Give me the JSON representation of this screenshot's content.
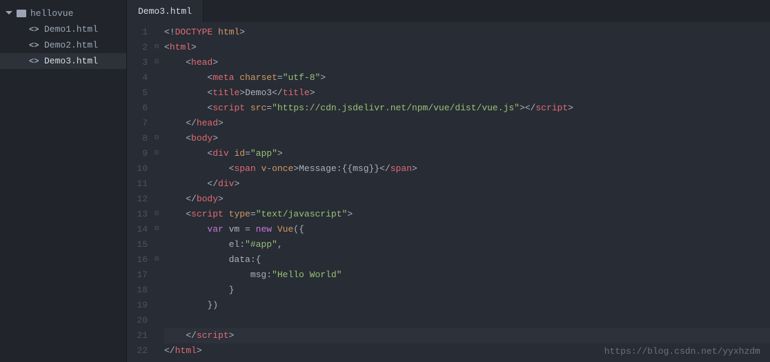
{
  "sidebar": {
    "folder": "hellovue",
    "files": [
      {
        "name": "Demo1.html",
        "selected": false
      },
      {
        "name": "Demo2.html",
        "selected": false
      },
      {
        "name": "Demo3.html",
        "selected": true
      }
    ]
  },
  "tabs": [
    {
      "label": "Demo3.html"
    }
  ],
  "lineCount": 22,
  "foldMarkers": {
    "2": "⊟",
    "3": "⊟",
    "8": "⊟",
    "9": "⊟",
    "13": "⊟",
    "14": "⊟",
    "16": "⊟"
  },
  "code": {
    "l1": {
      "indent": "",
      "tokens": [
        [
          "punct",
          "<!"
        ],
        [
          "tag-name",
          "DOCTYPE"
        ],
        [
          "text",
          " "
        ],
        [
          "attr-name",
          "html"
        ],
        [
          "punct",
          ">"
        ]
      ]
    },
    "l2": {
      "indent": "",
      "tokens": [
        [
          "punct",
          "<"
        ],
        [
          "tag-name",
          "html"
        ],
        [
          "punct",
          ">"
        ]
      ]
    },
    "l3": {
      "indent": "    ",
      "tokens": [
        [
          "punct",
          "<"
        ],
        [
          "tag-name",
          "head"
        ],
        [
          "punct",
          ">"
        ]
      ]
    },
    "l4": {
      "indent": "        ",
      "tokens": [
        [
          "punct",
          "<"
        ],
        [
          "tag-name",
          "meta"
        ],
        [
          "text",
          " "
        ],
        [
          "attr-name",
          "charset"
        ],
        [
          "punct",
          "="
        ],
        [
          "string",
          "\"utf-8\""
        ],
        [
          "punct",
          ">"
        ]
      ]
    },
    "l5": {
      "indent": "        ",
      "tokens": [
        [
          "punct",
          "<"
        ],
        [
          "tag-name",
          "title"
        ],
        [
          "punct",
          ">"
        ],
        [
          "text",
          "Demo3"
        ],
        [
          "punct",
          "</"
        ],
        [
          "tag-name",
          "title"
        ],
        [
          "punct",
          ">"
        ]
      ]
    },
    "l6": {
      "indent": "        ",
      "tokens": [
        [
          "punct",
          "<"
        ],
        [
          "tag-name",
          "script"
        ],
        [
          "text",
          " "
        ],
        [
          "attr-name",
          "src"
        ],
        [
          "punct",
          "="
        ],
        [
          "string",
          "\"https://cdn.jsdelivr.net/npm/vue/dist/vue.js\""
        ],
        [
          "punct",
          "></"
        ],
        [
          "tag-name",
          "script"
        ],
        [
          "punct",
          ">"
        ]
      ]
    },
    "l7": {
      "indent": "    ",
      "tokens": [
        [
          "punct",
          "</"
        ],
        [
          "tag-name",
          "head"
        ],
        [
          "punct",
          ">"
        ]
      ]
    },
    "l8": {
      "indent": "    ",
      "tokens": [
        [
          "punct",
          "<"
        ],
        [
          "tag-name",
          "body"
        ],
        [
          "punct",
          ">"
        ]
      ]
    },
    "l9": {
      "indent": "        ",
      "tokens": [
        [
          "punct",
          "<"
        ],
        [
          "tag-name",
          "div"
        ],
        [
          "text",
          " "
        ],
        [
          "attr-name",
          "id"
        ],
        [
          "punct",
          "="
        ],
        [
          "string",
          "\"app\""
        ],
        [
          "punct",
          ">"
        ]
      ]
    },
    "l10": {
      "indent": "            ",
      "tokens": [
        [
          "punct",
          "<"
        ],
        [
          "tag-name",
          "span"
        ],
        [
          "text",
          " "
        ],
        [
          "attr-name",
          "v-once"
        ],
        [
          "punct",
          ">"
        ],
        [
          "text",
          "Message:{{msg}}"
        ],
        [
          "punct",
          "</"
        ],
        [
          "tag-name",
          "span"
        ],
        [
          "punct",
          ">"
        ]
      ]
    },
    "l11": {
      "indent": "        ",
      "tokens": [
        [
          "punct",
          "</"
        ],
        [
          "tag-name",
          "div"
        ],
        [
          "punct",
          ">"
        ]
      ]
    },
    "l12": {
      "indent": "    ",
      "tokens": [
        [
          "punct",
          "</"
        ],
        [
          "tag-name",
          "body"
        ],
        [
          "punct",
          ">"
        ]
      ]
    },
    "l13": {
      "indent": "    ",
      "tokens": [
        [
          "punct",
          "<"
        ],
        [
          "tag-name",
          "script"
        ],
        [
          "text",
          " "
        ],
        [
          "attr-name",
          "type"
        ],
        [
          "punct",
          "="
        ],
        [
          "string",
          "\"text/javascript\""
        ],
        [
          "punct",
          ">"
        ]
      ]
    },
    "l14": {
      "indent": "        ",
      "tokens": [
        [
          "keyword",
          "var"
        ],
        [
          "text",
          " vm = "
        ],
        [
          "keyword",
          "new"
        ],
        [
          "text",
          " "
        ],
        [
          "attr-name",
          "Vue"
        ],
        [
          "text",
          "({"
        ]
      ]
    },
    "l15": {
      "indent": "            ",
      "tokens": [
        [
          "text",
          "el:"
        ],
        [
          "string",
          "\"#app\""
        ],
        [
          "text",
          ","
        ]
      ]
    },
    "l16": {
      "indent": "            ",
      "tokens": [
        [
          "text",
          "data:{"
        ]
      ]
    },
    "l17": {
      "indent": "                ",
      "tokens": [
        [
          "text",
          "msg:"
        ],
        [
          "string",
          "\"Hello World\""
        ]
      ]
    },
    "l18": {
      "indent": "            ",
      "tokens": [
        [
          "text",
          "}"
        ]
      ]
    },
    "l19": {
      "indent": "        ",
      "tokens": [
        [
          "text",
          "})"
        ]
      ]
    },
    "l20": {
      "indent": "",
      "tokens": []
    },
    "l21": {
      "indent": "    ",
      "tokens": [
        [
          "punct",
          "</"
        ],
        [
          "tag-name",
          "script"
        ],
        [
          "punct",
          ">"
        ]
      ],
      "highlighted": true
    },
    "l22": {
      "indent": "",
      "tokens": [
        [
          "punct",
          "</"
        ],
        [
          "tag-name",
          "html"
        ],
        [
          "punct",
          ">"
        ]
      ]
    }
  },
  "watermark": "https://blog.csdn.net/yyxhzdm"
}
